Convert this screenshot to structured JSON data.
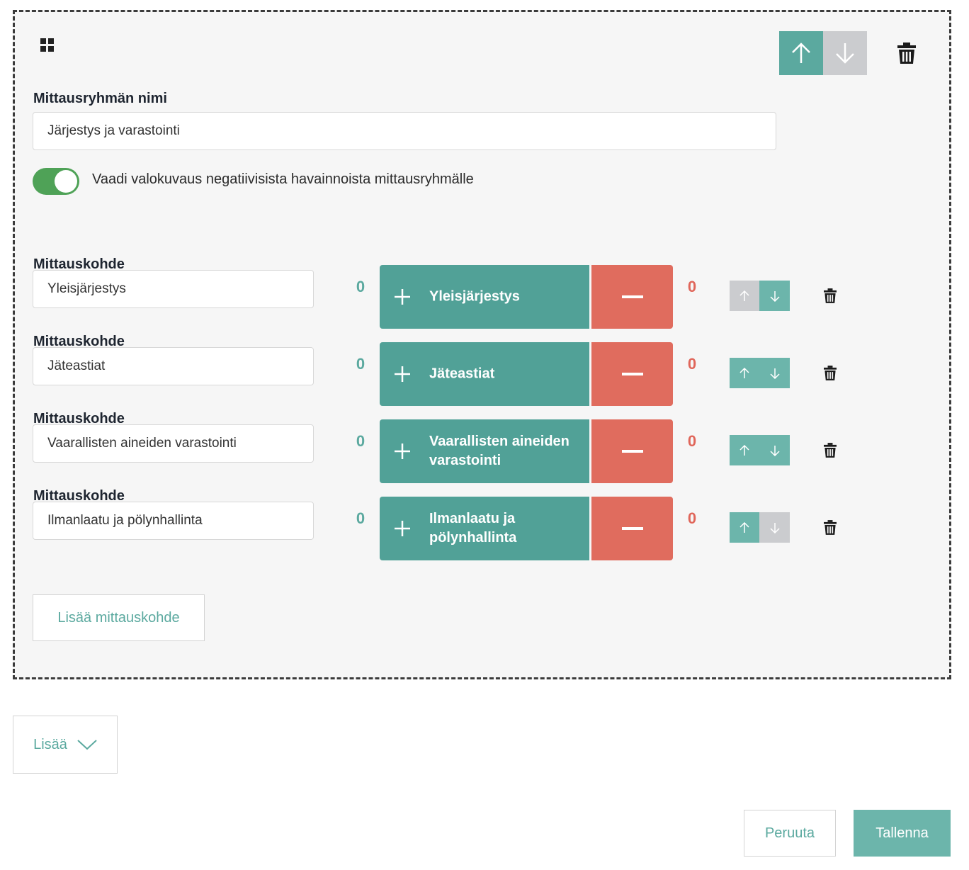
{
  "group": {
    "name_label": "Mittausryhmän nimi",
    "name_value": "Järjestys ja varastointi",
    "photo_toggle_on": true,
    "photo_toggle_label": "Vaadi valokuvaus negatiivisista havainnoista mittausryhmälle",
    "icons": {
      "drag": "grid-drag-icon",
      "up": "arrow-up-icon",
      "down": "arrow-down-icon",
      "delete": "trash-icon"
    }
  },
  "items": [
    {
      "label": "Mittauskohde",
      "value": "Yleisjärjestys",
      "positive_count": "0",
      "button_text": "Yleisjärjestys",
      "negative_count": "0"
    },
    {
      "label": "Mittauskohde",
      "value": "Jäteastiat",
      "positive_count": "0",
      "button_text": "Jäteastiat",
      "negative_count": "0"
    },
    {
      "label": "Mittauskohde",
      "value": "Vaarallisten aineiden varastointi",
      "positive_count": "0",
      "button_text": "Vaarallisten aineiden varastointi",
      "negative_count": "0"
    },
    {
      "label": "Mittauskohde",
      "value": "Ilmanlaatu ja pölynhallinta",
      "positive_count": "0",
      "button_text": "Ilmanlaatu ja pölynhallinta",
      "negative_count": "0"
    }
  ],
  "add_item_label": "Lisää mittauskohde",
  "add_label": "Lisää",
  "cancel_label": "Peruuta",
  "save_label": "Tallenna",
  "colors": {
    "teal": "#51a197",
    "teal_light": "#6cb5ab",
    "red": "#e06c5e",
    "grey": "#cbcccf",
    "toggle_green": "#4fa257"
  }
}
